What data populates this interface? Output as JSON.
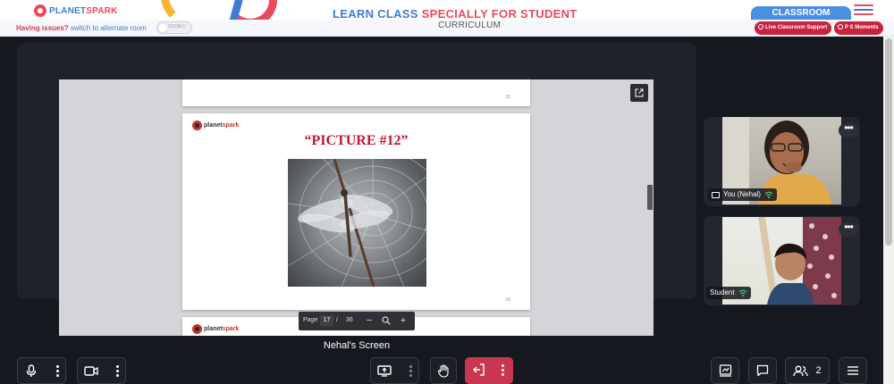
{
  "header": {
    "logo_left": "PLANET",
    "logo_right": "SPARK",
    "headline_blue": "LEARN CLASS ",
    "headline_red": "SPECIALLY FOR STUDENT",
    "classroom_label": "CLASSROOM",
    "menu_icon": "hamburger-icon"
  },
  "subbar": {
    "issues_question": "Having issues?",
    "issues_link": "switch to alternate room",
    "toggle_text": "ZOOM 1",
    "curriculum": "CURRICULUM",
    "live_support": "Live Classroom Support",
    "ps_moments": "P S Moments"
  },
  "viewer": {
    "prev_page_number": "15",
    "logo_left": "planet",
    "logo_right": "spark",
    "picture_title": "“PICTURE #12”",
    "page_number": "16",
    "pager": {
      "label": "Page",
      "current": "17",
      "separator": "/",
      "total": "36"
    },
    "popout_icon": "external-link-icon"
  },
  "screen_label": "Nehal's Screen",
  "participants": [
    {
      "name": "You (Nehal)",
      "status_icon": "wifi-icon"
    },
    {
      "name": "Student",
      "status_icon": "wifi-icon"
    }
  ],
  "toolbar": {
    "people_count": "2",
    "icons": [
      "microphone-icon",
      "camera-icon",
      "screen-share-icon",
      "raise-hand-icon",
      "leave-icon",
      "whiteboard-icon",
      "chat-icon",
      "people-icon",
      "menu-icon"
    ]
  },
  "colors": {
    "brand_blue": "#3d7bd6",
    "brand_red": "#e84b5a",
    "stage_bg": "#16181f",
    "leave_red": "#c9364f",
    "title_red": "#c0182e"
  }
}
